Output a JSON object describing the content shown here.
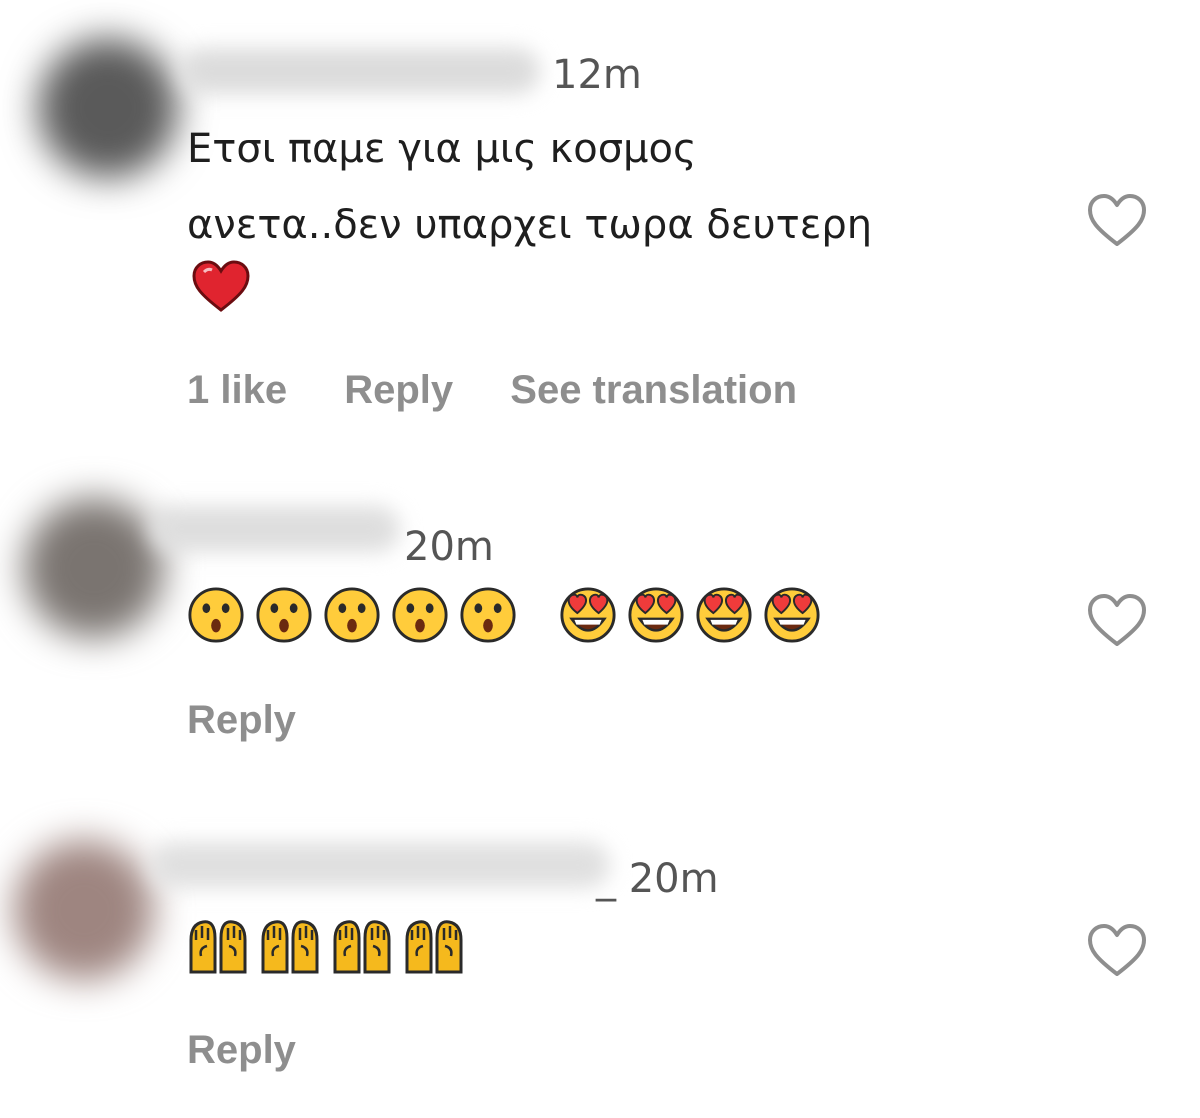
{
  "colors": {
    "text": "#1e1e1e",
    "meta": "#8e8e8e",
    "time": "#555555",
    "heart": "#e0242f"
  },
  "comments": [
    {
      "time": "12m",
      "lines": [
        "Ετσι παμε για μις κοσμος",
        "ανετα..δεν υπαρχει τωρα δευτερη"
      ],
      "trailing_emoji": "red-heart",
      "likes_label": "1 like",
      "reply_label": "Reply",
      "translate_label": "See translation"
    },
    {
      "time": "20m",
      "emojis": [
        "hushed-face",
        "hushed-face",
        "hushed-face",
        "hushed-face",
        "hushed-face",
        "heart-eyes-face",
        "heart-eyes-face",
        "heart-eyes-face",
        "heart-eyes-face"
      ],
      "reply_label": "Reply"
    },
    {
      "time": "20m",
      "username_suffix": "_",
      "emojis": [
        "raising-hands",
        "raising-hands",
        "raising-hands",
        "raising-hands"
      ],
      "reply_label": "Reply"
    }
  ]
}
